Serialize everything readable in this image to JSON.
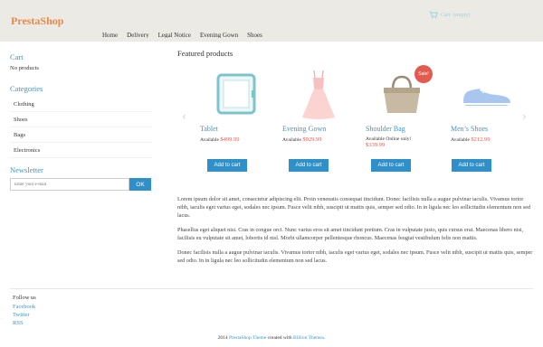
{
  "header": {
    "logo": "PrestaShop",
    "cart_label": "Cart",
    "cart_status": "(empty)",
    "nav": [
      "Home",
      "Delivery",
      "Legal Notice",
      "Evening Gown",
      "Shoes"
    ]
  },
  "sidebar": {
    "cart_title": "Cart",
    "cart_empty": "No products",
    "categories_title": "Categories",
    "categories": [
      "Clothing",
      "Shoes",
      "Bags",
      "Electronics"
    ],
    "newsletter_title": "Newsletter",
    "newsletter_placeholder": "Enter your e-mail",
    "newsletter_button": "OK"
  },
  "main": {
    "featured_title": "Featured products",
    "products": [
      {
        "name": "Tablet",
        "availability": "Available",
        "price": "$499.99",
        "button": "Add to cart",
        "icon": "tablet-icon"
      },
      {
        "name": "Evening Gown",
        "availability": "Available",
        "price": "$929.99",
        "button": "Add to cart",
        "icon": "dress-icon"
      },
      {
        "name": "Shoulder Bag",
        "availability": "Available Online only!",
        "price": "$339.99",
        "button": "Add to cart",
        "badge": "Sale!",
        "icon": "bag-icon"
      },
      {
        "name": "Men’s Shoes",
        "availability": "Available",
        "price": "$212.99",
        "button": "Add to cart",
        "icon": "shoe-icon"
      }
    ],
    "paragraphs": [
      "Lorem ipsum dolor sit amet, consectetur adipiscing elit. Proin venenatis consequat tincidunt. Donec facilisis nulla a augue pulvinar iaculis. Vivamus tortor nibh, iaculis eget varius eget, sodales nec ipsum. Fusce velit nibh, suscipit ut mattis quis, semper sed odio. In in ligula nec leo sollicitudin elementum non sed lacus.",
      "Phasellus eget aliquet nisi. Cras in congue orci. Nunc varius eros sit amet tincidunt pretium. Cras in vulputate justo, quis cursus erat. Maecenas libero nisi, facilisis eu vulputate sit amet, lobortis id nisl. Morbi ullamcorper pellentesque rhoncus. Maecenas feugiat vestibulum felis non mattis.",
      "Donec facilisis nulla a augue pulvinar iaculis. Vivamus tortor nibh, iaculis eget varius eget, sodales nec ipsum. Fusce velit nibh, suscipit ut mattis quis, semper sed odio. In in ligula nec leo sollicitudin elementum non sed lacus."
    ]
  },
  "footer": {
    "follow_title": "Follow us",
    "links": [
      "Facebook",
      "Twitter",
      "RSS"
    ],
    "copyright_prefix": "2014",
    "theme_link": "PrestaShop Theme",
    "created_with": "created with",
    "author_link": "Billion Themes",
    "period": "."
  },
  "colors": {
    "accent": "#3a96c8",
    "logo": "#e98a4a",
    "price": "#e35b4f",
    "button": "#2e8fc9",
    "header_bg": "#eceae4"
  }
}
